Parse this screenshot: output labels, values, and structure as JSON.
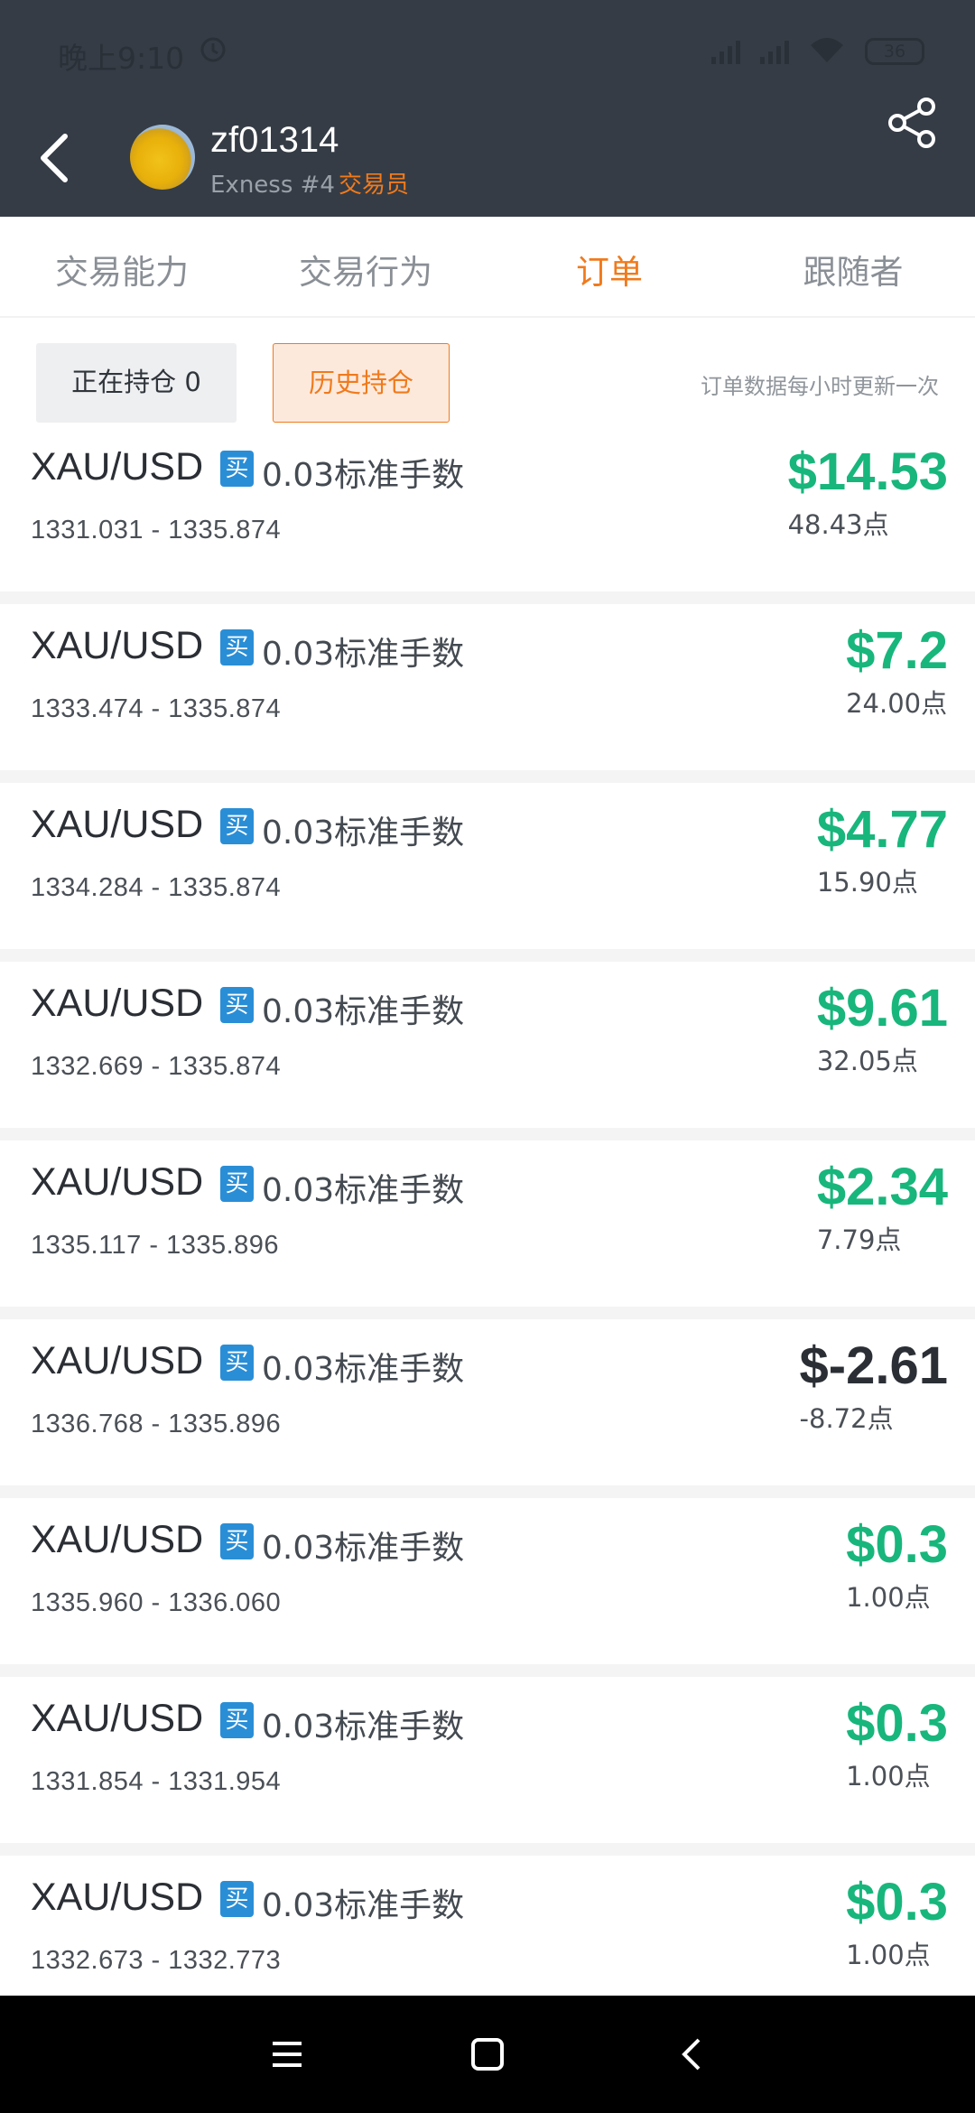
{
  "status_bar": {
    "time": "晚上9:10",
    "battery": "36"
  },
  "header": {
    "user_name": "zf01314",
    "broker": "Exness #4",
    "role": "交易员"
  },
  "tabs": [
    {
      "label": "交易能力",
      "active": false
    },
    {
      "label": "交易行为",
      "active": false
    },
    {
      "label": "订单",
      "active": true
    },
    {
      "label": "跟随者",
      "active": false
    }
  ],
  "filters": {
    "open_positions": "正在持仓 0",
    "history_positions": "历史持仓",
    "update_note": "订单数据每小时更新一次"
  },
  "colors": {
    "profit": "#18b67c",
    "loss": "#2b2f35",
    "accent": "#f07a1c",
    "buy_badge": "#2a8ed6",
    "header_bg": "#353c45"
  },
  "orders": [
    {
      "symbol": "XAU/USD",
      "side": "买",
      "lots": "0.03标准手数",
      "prices": "1331.031 - 1335.874",
      "profit": "$14.53",
      "points": "48.43点",
      "is_loss": false
    },
    {
      "symbol": "XAU/USD",
      "side": "买",
      "lots": "0.03标准手数",
      "prices": "1333.474 - 1335.874",
      "profit": "$7.2",
      "points": "24.00点",
      "is_loss": false
    },
    {
      "symbol": "XAU/USD",
      "side": "买",
      "lots": "0.03标准手数",
      "prices": "1334.284 - 1335.874",
      "profit": "$4.77",
      "points": "15.90点",
      "is_loss": false
    },
    {
      "symbol": "XAU/USD",
      "side": "买",
      "lots": "0.03标准手数",
      "prices": "1332.669 - 1335.874",
      "profit": "$9.61",
      "points": "32.05点",
      "is_loss": false
    },
    {
      "symbol": "XAU/USD",
      "side": "买",
      "lots": "0.03标准手数",
      "prices": "1335.117 - 1335.896",
      "profit": "$2.34",
      "points": "7.79点",
      "is_loss": false
    },
    {
      "symbol": "XAU/USD",
      "side": "买",
      "lots": "0.03标准手数",
      "prices": "1336.768 - 1335.896",
      "profit": "$-2.61",
      "points": "-8.72点",
      "is_loss": true
    },
    {
      "symbol": "XAU/USD",
      "side": "买",
      "lots": "0.03标准手数",
      "prices": "1335.960 - 1336.060",
      "profit": "$0.3",
      "points": "1.00点",
      "is_loss": false
    },
    {
      "symbol": "XAU/USD",
      "side": "买",
      "lots": "0.03标准手数",
      "prices": "1331.854 - 1331.954",
      "profit": "$0.3",
      "points": "1.00点",
      "is_loss": false
    },
    {
      "symbol": "XAU/USD",
      "side": "买",
      "lots": "0.03标准手数",
      "prices": "1332.673 - 1332.773",
      "profit": "$0.3",
      "points": "1.00点",
      "is_loss": false
    }
  ]
}
